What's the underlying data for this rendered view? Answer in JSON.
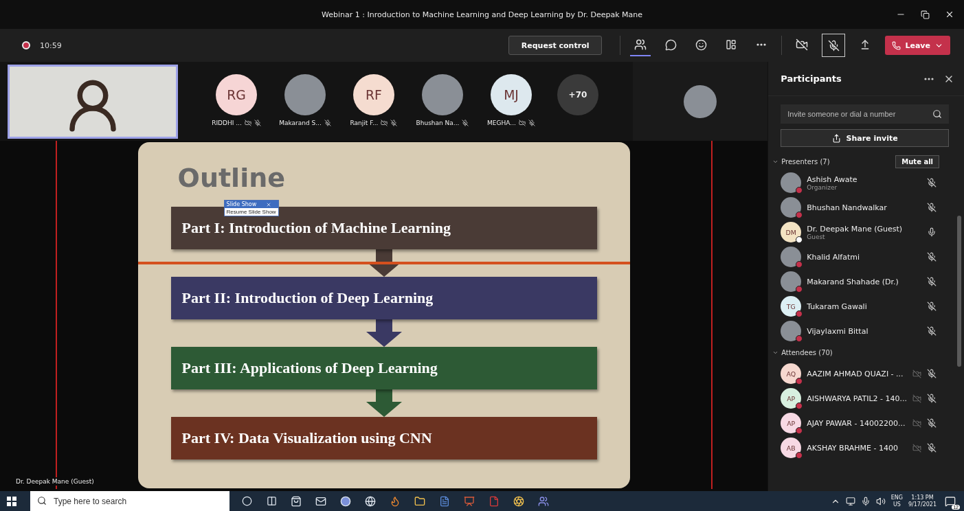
{
  "window": {
    "title": "Webinar 1 : Inroduction to Machine Learning and Deep Learning by Dr. Deepak Mane"
  },
  "toolbar": {
    "recording": true,
    "timer": "10:59",
    "request_control": "Request control",
    "leave": "Leave",
    "people_selected": true
  },
  "gallery": {
    "tiles": [
      {
        "avatar": {
          "kind": "initials",
          "text": "RG",
          "color": "#f6d5d5"
        },
        "name": "RIDDHI ...",
        "video_off": true,
        "muted": true
      },
      {
        "avatar": {
          "kind": "photo"
        },
        "name": "Makarand S...",
        "muted": true
      },
      {
        "avatar": {
          "kind": "initials",
          "text": "RF",
          "color": "#f5dcd0"
        },
        "name": "Ranjit F...",
        "video_off": true,
        "muted": true
      },
      {
        "avatar": {
          "kind": "photo"
        },
        "name": "Bhushan Na...",
        "muted": true
      },
      {
        "avatar": {
          "kind": "initials",
          "text": "MJ",
          "color": "#dde8ee"
        },
        "name": "MEGHA...",
        "video_off": true,
        "muted": true
      }
    ],
    "overflow": "+70"
  },
  "stage": {
    "speaker": "Dr. Deepak Mane (Guest)",
    "slide": {
      "title": "Outline",
      "toolbar_title": "Slide Show",
      "toolbar_item": "Resume Slide Show",
      "parts": [
        {
          "text": "Part I: Introduction of Machine Learning",
          "color": "#4a3b36"
        },
        {
          "text": "Part II:  Introduction of Deep Learning",
          "color": "#3a3963"
        },
        {
          "text": "Part III: Applications of Deep Learning",
          "color": "#2d5a35"
        },
        {
          "text": "Part IV:  Data Visualization using CNN",
          "color": "#6b3221"
        }
      ]
    }
  },
  "participants": {
    "title": "Participants",
    "search": {
      "placeholder": "Invite someone or dial a number"
    },
    "share_invite": "Share invite",
    "sections": [
      {
        "title": "Presenters (7)",
        "expanded": true,
        "action": "Mute all",
        "people": [
          {
            "name": "Ashish Awate",
            "role": "Organizer",
            "avatar": {
              "kind": "photo"
            },
            "status": {
              "color": "#c4314b"
            },
            "muted": true
          },
          {
            "name": "Bhushan Nandwalkar",
            "avatar": {
              "kind": "photo"
            },
            "status": {
              "color": "#c4314b"
            },
            "muted": true
          },
          {
            "name": "Dr. Deepak Mane (Guest)",
            "role": "Guest",
            "avatar": {
              "kind": "initials",
              "text": "DM",
              "color": "#f3e3c3"
            },
            "status": {
              "color": "#ffffff"
            },
            "muted": false
          },
          {
            "name": "Khalid Alfatmi",
            "avatar": {
              "kind": "photo"
            },
            "status": {
              "color": "#c4314b"
            },
            "muted": true
          },
          {
            "name": "Makarand Shahade (Dr.)",
            "avatar": {
              "kind": "photo"
            },
            "status": {
              "color": "#c4314b"
            },
            "muted": true
          },
          {
            "name": "Tukaram Gawali",
            "avatar": {
              "kind": "initials",
              "text": "TG",
              "color": "#dceff4"
            },
            "status": {
              "color": "#c4314b"
            },
            "muted": true
          },
          {
            "name": "Vijaylaxmi Bittal",
            "avatar": {
              "kind": "photo"
            },
            "status": {
              "color": "#c4314b"
            },
            "muted": true
          }
        ]
      },
      {
        "title": "Attendees (70)",
        "expanded": true,
        "people": [
          {
            "name": "AAZIM AHMAD QUAZI - ...",
            "avatar": {
              "kind": "initials",
              "text": "AQ",
              "color": "#f6d8cf"
            },
            "status": {
              "color": "#c4314b"
            },
            "video_off": true,
            "muted": true
          },
          {
            "name": "AISHWARYA PATIL2 - 140...",
            "avatar": {
              "kind": "initials",
              "text": "AP",
              "color": "#d8f0e0"
            },
            "status": {
              "color": "#c4314b"
            },
            "video_off": true,
            "muted": true
          },
          {
            "name": "AJAY PAWAR - 14002200...",
            "avatar": {
              "kind": "initials",
              "text": "AP",
              "color": "#f7d9e4"
            },
            "status": {
              "color": "#c4314b"
            },
            "video_off": true,
            "muted": true
          },
          {
            "name": "AKSHAY BRAHME - 1400",
            "avatar": {
              "kind": "initials",
              "text": "AB",
              "color": "#f7d9e4"
            },
            "status": {
              "color": "#c4314b"
            },
            "video_off": true,
            "muted": true
          }
        ]
      }
    ]
  },
  "taskbar": {
    "search": {
      "placeholder": "Type here to search"
    },
    "language": "ENG",
    "region": "US",
    "time": "1:13 PM",
    "date": "9/17/2021",
    "notifications": "12"
  }
}
